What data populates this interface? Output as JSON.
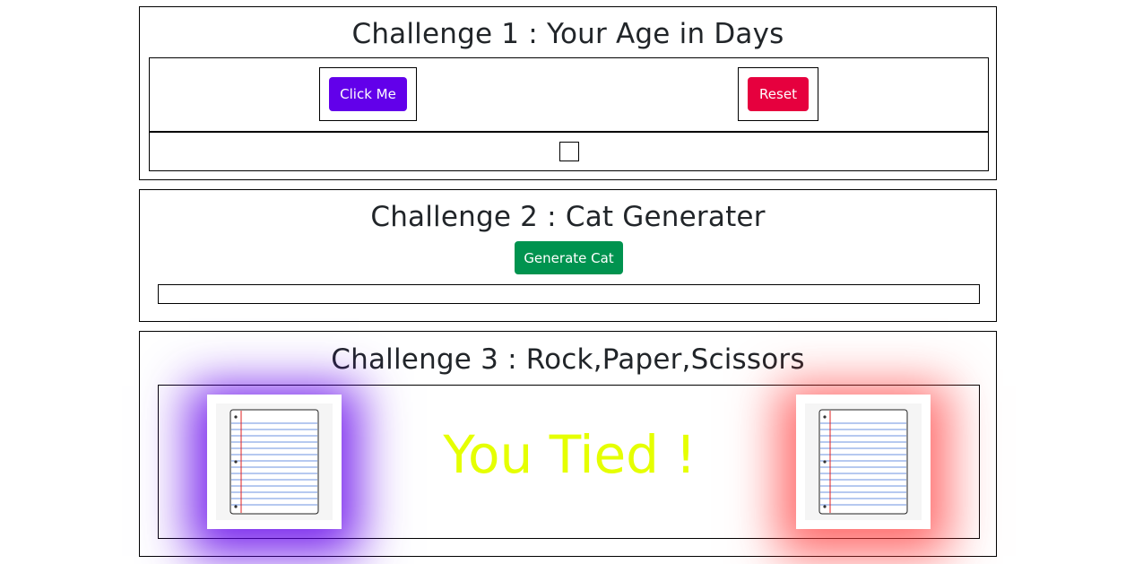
{
  "challenge1": {
    "title": "Challenge 1 : Your Age in Days",
    "click_label": "Click Me",
    "reset_label": "Reset"
  },
  "challenge2": {
    "title": "Challenge 2 : Cat Generater",
    "generate_label": "Generate Cat"
  },
  "challenge3": {
    "title": "Challenge 3 : Rock,Paper,Scissors",
    "result": "You Tied !",
    "result_color": "#e5ff00",
    "human_choice": "paper",
    "bot_choice": "paper",
    "human_glow": "#6200ea",
    "bot_glow": "#ff3b3b"
  }
}
